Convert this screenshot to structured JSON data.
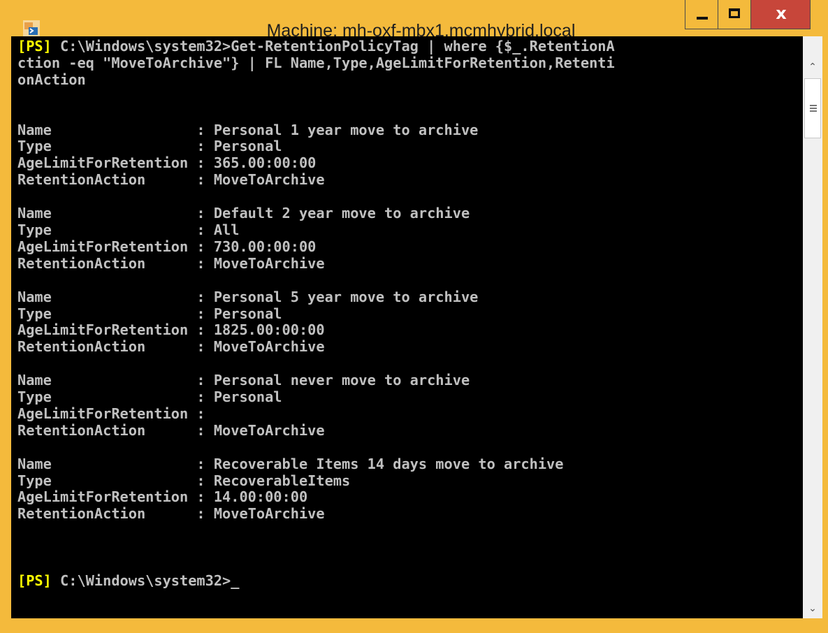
{
  "window": {
    "title": "Machine: mh-oxf-mbx1.mcmhybrid.local",
    "icon": "powershell-icon",
    "buttons": {
      "minimize": "minimize-icon",
      "maximize": "maximize-icon",
      "close_label": "x"
    },
    "colors": {
      "frame": "#f4ba3c",
      "close": "#c7463a",
      "console_bg": "#000000",
      "console_fg": "#c0c0c0",
      "prompt": "#ffff00"
    }
  },
  "console": {
    "command_prompt": "[PS]",
    "command_text": " C:\\Windows\\system32>Get-RetentionPolicyTag | where {$_.RetentionA\nction -eq \"MoveToArchive\"} | FL Name,Type,AgeLimitForRetention,Retenti\nonAction",
    "output": "\n\n\nName                 : Personal 1 year move to archive\nType                 : Personal\nAgeLimitForRetention : 365.00:00:00\nRetentionAction      : MoveToArchive\n\nName                 : Default 2 year move to archive\nType                 : All\nAgeLimitForRetention : 730.00:00:00\nRetentionAction      : MoveToArchive\n\nName                 : Personal 5 year move to archive\nType                 : Personal\nAgeLimitForRetention : 1825.00:00:00\nRetentionAction      : MoveToArchive\n\nName                 : Personal never move to archive\nType                 : Personal\nAgeLimitForRetention :\nRetentionAction      : MoveToArchive\n\nName                 : Recoverable Items 14 days move to archive\nType                 : RecoverableItems\nAgeLimitForRetention : 14.00:00:00\nRetentionAction      : MoveToArchive\n\n\n\n",
    "final_prompt": "[PS]",
    "final_prompt_text": " C:\\Windows\\system32>",
    "cursor": "_"
  },
  "scrollbar": {
    "up_icon": "chevron-up-icon",
    "down_icon": "chevron-down-icon",
    "up_glyph": "⌃",
    "down_glyph": "⌄"
  }
}
